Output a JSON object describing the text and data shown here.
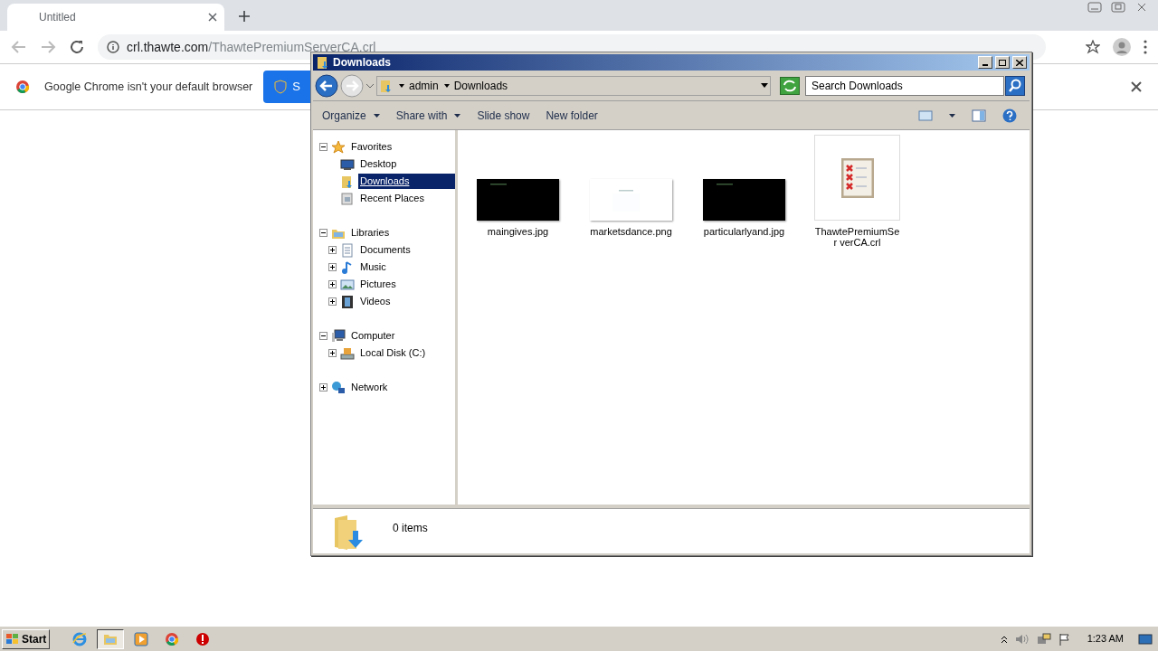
{
  "browser": {
    "tab": {
      "title": "Untitled",
      "selected": true
    },
    "url": {
      "host": "crl.thawte.com",
      "path": "/ThawtePremiumServerCA.crl"
    },
    "infobar": {
      "message": "Google Chrome isn't your default browser",
      "button": "S"
    }
  },
  "explorer": {
    "title": "Downloads",
    "breadcrumb": [
      "admin",
      "Downloads"
    ],
    "search": {
      "placeholder": "Search Downloads"
    },
    "commands": [
      {
        "label": "Organize",
        "dropdown": true
      },
      {
        "label": "Share with",
        "dropdown": true
      },
      {
        "label": "Slide show",
        "dropdown": false
      },
      {
        "label": "New folder",
        "dropdown": false
      }
    ],
    "tree": [
      {
        "label": "Favorites",
        "kind": "star",
        "expanded": true,
        "selected": false,
        "children": [
          {
            "label": "Desktop",
            "kind": "desktop",
            "selected": false
          },
          {
            "label": "Downloads",
            "kind": "downloads",
            "selected": true
          },
          {
            "label": "Recent Places",
            "kind": "recent",
            "selected": false
          }
        ]
      },
      {
        "label": "Libraries",
        "kind": "library",
        "expanded": true,
        "selected": false,
        "children": [
          {
            "label": "Documents",
            "kind": "document",
            "expanded": false,
            "selected": false
          },
          {
            "label": "Music",
            "kind": "music",
            "expanded": false,
            "selected": false
          },
          {
            "label": "Pictures",
            "kind": "pictures",
            "expanded": false,
            "selected": false
          },
          {
            "label": "Videos",
            "kind": "videos",
            "expanded": false,
            "selected": false
          }
        ]
      },
      {
        "label": "Computer",
        "kind": "computer",
        "expanded": true,
        "selected": false,
        "children": [
          {
            "label": "Local Disk (C:)",
            "kind": "disk",
            "expanded": false,
            "selected": false
          }
        ]
      },
      {
        "label": "Network",
        "kind": "network",
        "expanded": false,
        "selected": false
      }
    ],
    "files": [
      {
        "name": "maingives.jpg",
        "kind": "dark"
      },
      {
        "name": "marketsdance.png",
        "kind": "light"
      },
      {
        "name": "particularlyand.jpg",
        "kind": "dark"
      },
      {
        "name": "ThawtePremiumSer verCA.crl",
        "kind": "certificate"
      }
    ],
    "status": "0 items"
  },
  "taskbar": {
    "start": "Start",
    "apps": [
      {
        "kind": "ie",
        "selected": false
      },
      {
        "kind": "explorer",
        "selected": true
      },
      {
        "kind": "media",
        "selected": false
      },
      {
        "kind": "chrome",
        "selected": false
      },
      {
        "kind": "stop",
        "selected": false
      }
    ],
    "clock": "1:23 AM"
  }
}
